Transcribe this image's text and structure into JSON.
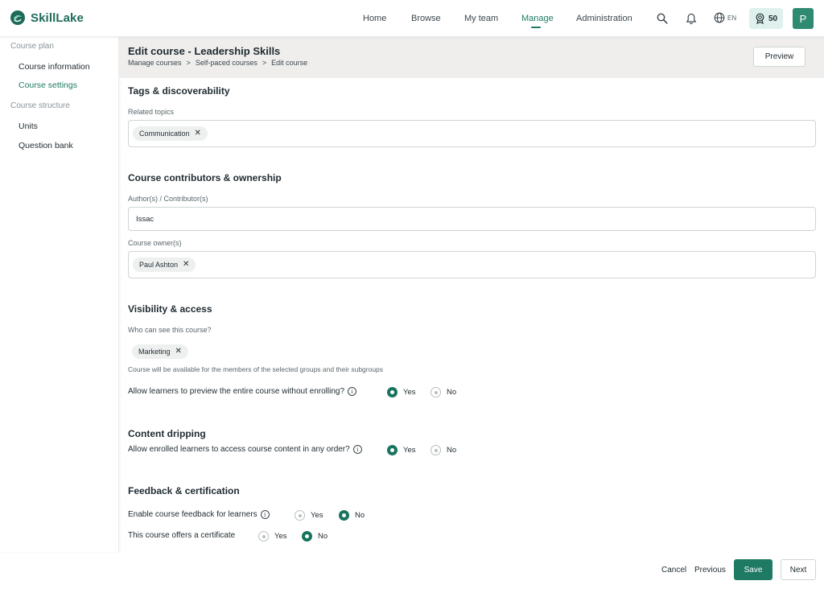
{
  "app": {
    "name": "SkillLake"
  },
  "nav": {
    "items": [
      {
        "label": "Home"
      },
      {
        "label": "Browse"
      },
      {
        "label": "My team"
      },
      {
        "label": "Manage"
      },
      {
        "label": "Administration"
      }
    ],
    "active": "Manage",
    "language": "EN",
    "points": "50",
    "avatar_initial": "P"
  },
  "sidebar": {
    "groups": [
      {
        "label": "Course plan",
        "items": [
          {
            "label": "Course information"
          },
          {
            "label": "Course settings"
          }
        ]
      },
      {
        "label": "Course structure",
        "items": [
          {
            "label": "Units"
          },
          {
            "label": "Question bank"
          }
        ]
      }
    ],
    "active_item": "Course settings"
  },
  "header": {
    "title": "Edit course - Leadership Skills",
    "breadcrumb": [
      "Manage courses",
      ">",
      "Self-paced courses",
      ">",
      "Edit course"
    ],
    "preview_label": "Preview"
  },
  "tags": {
    "title": "Tags & discoverability",
    "related_label": "Related topics",
    "related_chips": [
      "Communication"
    ]
  },
  "contributors": {
    "title": "Course contributors & ownership",
    "authors_label": "Author(s) / Contributor(s)",
    "authors_value": "Issac",
    "owners_label": "Course owner(s)",
    "owner_chips": [
      "Paul Ashton"
    ]
  },
  "visibility": {
    "title": "Visibility & access",
    "who_label": "Who can see this course?",
    "group_chips": [
      "Marketing"
    ],
    "helper": "Course will be available for the members of the selected groups and their subgroups",
    "preview_question": "Allow learners to preview the entire course without enrolling?",
    "preview_yes": "Yes",
    "preview_no": "No",
    "preview_selected": "Yes"
  },
  "dripping": {
    "title": "Content dripping",
    "question": "Allow enrolled learners to access course content in any order?",
    "yes": "Yes",
    "no": "No",
    "selected": "Yes"
  },
  "feedback": {
    "title": "Feedback & certification",
    "feedback_question": "Enable course feedback for learners",
    "feedback_yes": "Yes",
    "feedback_no": "No",
    "feedback_selected": "No",
    "certificate_question": "This course offers a certificate",
    "certificate_yes": "Yes",
    "certificate_no": "No",
    "certificate_selected": "No"
  },
  "footer": {
    "cancel_label": "Cancel",
    "previous_label": "Previous",
    "save_label": "Save",
    "next_label": "Next"
  },
  "colors": {
    "brand": "#1f7a64",
    "header_band": "#efeeed",
    "points_bg": "#dff1ec"
  },
  "icons": {
    "search": "search-icon",
    "notifications": "bell-icon",
    "language": "globe-icon",
    "points": "badge-icon",
    "info": "info-icon",
    "remove": "close-icon"
  }
}
